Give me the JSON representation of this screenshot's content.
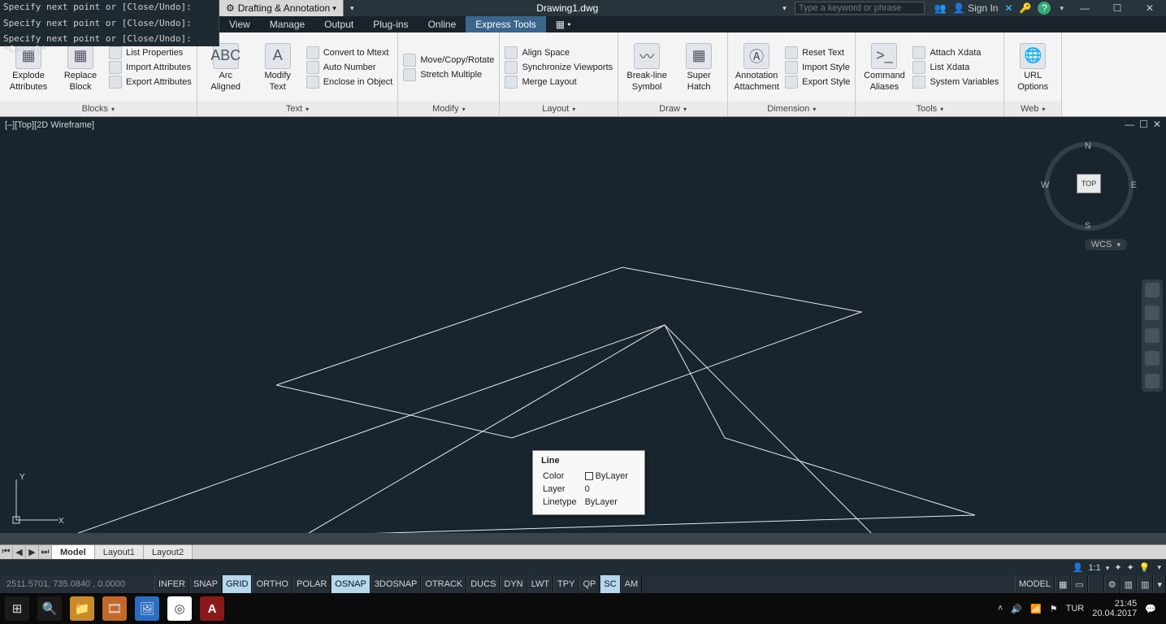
{
  "app": {
    "title": "Drawing1.dwg",
    "workspace_ws": "Drafting & Annotation",
    "search_placeholder": "Type a keyword or phrase",
    "signin": "Sign In"
  },
  "cmd_history": {
    "line1": "Specify next point or [Close/Undo]:",
    "line2": "Specify next point or [Close/Undo]:",
    "line3": "Specify next point or [Close/Undo]: *Cancel*"
  },
  "menu_tabs": [
    "View",
    "Manage",
    "Output",
    "Plug-ins",
    "Online",
    "Express Tools"
  ],
  "menu_active_index": 5,
  "ribbon": {
    "panels": [
      {
        "title": "Blocks",
        "big": [
          {
            "label1": "Explode",
            "label2": "Attributes"
          },
          {
            "label1": "Replace",
            "label2": "Block"
          }
        ],
        "rows": [
          "List Properties",
          "Import Attributes",
          "Export Attributes"
        ]
      },
      {
        "title": "Text",
        "big": [
          {
            "label1": "Arc",
            "label2": "Aligned"
          },
          {
            "label1": "Modify",
            "label2": "Text"
          }
        ],
        "rows": [
          "Convert to Mtext",
          "Auto Number",
          "Enclose in Object"
        ]
      },
      {
        "title": "Modify",
        "rows": [
          "Move/Copy/Rotate",
          "Stretch Multiple"
        ]
      },
      {
        "title": "Layout",
        "rows": [
          "Align Space",
          "Synchronize Viewports",
          "Merge Layout"
        ]
      },
      {
        "title": "Draw",
        "big": [
          {
            "label1": "Break-line",
            "label2": "Symbol"
          },
          {
            "label1": "Super",
            "label2": "Hatch"
          }
        ]
      },
      {
        "title": "Dimension",
        "big": [
          {
            "label1": "Annotation",
            "label2": "Attachment"
          }
        ],
        "rows": [
          "Reset Text",
          "Import Style",
          "Export Style"
        ]
      },
      {
        "title": "Tools",
        "big": [
          {
            "label1": "Command",
            "label2": "Aliases"
          }
        ],
        "rows": [
          "Attach Xdata",
          "List Xdata",
          "System Variables"
        ]
      },
      {
        "title": "Web",
        "big": [
          {
            "label1": "URL",
            "label2": "Options"
          }
        ]
      }
    ]
  },
  "viewport": {
    "label": "[–][Top][2D Wireframe]",
    "viewcube": {
      "face": "TOP",
      "n": "N",
      "e": "E",
      "s": "S",
      "w": "W"
    },
    "wcs": "WCS",
    "ucs": {
      "x": "X",
      "y": "Y"
    }
  },
  "tooltip": {
    "title": "Line",
    "props": {
      "color_label": "Color",
      "color_value": "ByLayer",
      "layer_label": "Layer",
      "layer_value": "0",
      "linetype_label": "Linetype",
      "linetype_value": "ByLayer"
    }
  },
  "layout_tabs": [
    "Model",
    "Layout1",
    "Layout2"
  ],
  "layout_active_index": 0,
  "anno_scale": "1:1",
  "status": {
    "coords": "2511.5701, 735.0840 , 0.0000",
    "toggles": [
      {
        "t": "INFER",
        "on": false
      },
      {
        "t": "SNAP",
        "on": false
      },
      {
        "t": "GRID",
        "on": true
      },
      {
        "t": "ORTHO",
        "on": false
      },
      {
        "t": "POLAR",
        "on": false
      },
      {
        "t": "OSNAP",
        "on": true
      },
      {
        "t": "3DOSNAP",
        "on": false
      },
      {
        "t": "OTRACK",
        "on": false
      },
      {
        "t": "DUCS",
        "on": false
      },
      {
        "t": "DYN",
        "on": false
      },
      {
        "t": "LWT",
        "on": false
      },
      {
        "t": "TPY",
        "on": false
      },
      {
        "t": "QP",
        "on": false
      },
      {
        "t": "SC",
        "on": true
      },
      {
        "t": "AM",
        "on": false
      }
    ],
    "model_btn": "MODEL"
  },
  "taskbar": {
    "lang": "TUR",
    "time": "21:45",
    "date": "20.04.2017"
  },
  "glyphs": {
    "gear": "⚙",
    "dd": "▾",
    "person": "👤",
    "x1": "✕",
    "help": "?",
    "min": "—",
    "max": "☐",
    "close": "✕",
    "first": "⏮",
    "prev": "◀",
    "next": "▶",
    "last": "⏭",
    "win": "⊞",
    "search": "🔍",
    "folder": "📁",
    "film": "🎞",
    "img": "🖼",
    "chrome": "◎",
    "acadA": "A",
    "up": "˄",
    "speaker": "🔊",
    "net": "📶",
    "flag": "⚑",
    "notif": "💬",
    "abc": "ABC",
    "textA": "A",
    "earth": "🌐",
    "cmd": ">_",
    "people": "👥",
    "exch": "✕",
    "keys": "🔑"
  }
}
